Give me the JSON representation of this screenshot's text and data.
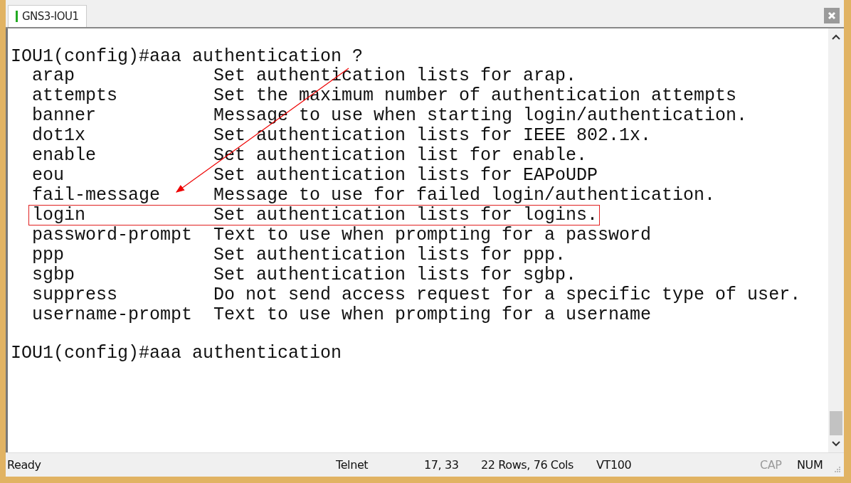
{
  "tab": {
    "title": "GNS3-IOU1",
    "selected": true
  },
  "terminal": {
    "prompt_top": "IOU1(config)#aaa authentication ?",
    "options": [
      {
        "command": "arap",
        "description": "Set authentication lists for arap.",
        "highlighted": false
      },
      {
        "command": "attempts",
        "description": "Set the maximum number of authentication attempts",
        "highlighted": false
      },
      {
        "command": "banner",
        "description": "Message to use when starting login/authentication.",
        "highlighted": false
      },
      {
        "command": "dot1x",
        "description": "Set authentication lists for IEEE 802.1x.",
        "highlighted": false
      },
      {
        "command": "enable",
        "description": "Set authentication list for enable.",
        "highlighted": false
      },
      {
        "command": "eou",
        "description": "Set authentication lists for EAPoUDP",
        "highlighted": false
      },
      {
        "command": "fail-message",
        "description": "Message to use for failed login/authentication.",
        "highlighted": false
      },
      {
        "command": "login",
        "description": "Set authentication lists for logins.",
        "highlighted": true
      },
      {
        "command": "password-prompt",
        "description": "Text to use when prompting for a password",
        "highlighted": false
      },
      {
        "command": "ppp",
        "description": "Set authentication lists for ppp.",
        "highlighted": false
      },
      {
        "command": "sgbp",
        "description": "Set authentication lists for sgbp.",
        "highlighted": false
      },
      {
        "command": "suppress",
        "description": "Do not send access request for a specific type of user.",
        "highlighted": false
      },
      {
        "command": "username-prompt",
        "description": "Text to use when prompting for a username",
        "highlighted": false
      }
    ],
    "prompt_bottom": "IOU1(config)#aaa authentication"
  },
  "status_bar": {
    "message": "Ready",
    "protocol": "Telnet",
    "cursor": "17,  33",
    "size": "22 Rows,  76 Cols",
    "emulation": "VT100",
    "indicators": [
      {
        "label": "CAP",
        "on": false
      },
      {
        "label": "NUM",
        "on": true
      }
    ]
  }
}
